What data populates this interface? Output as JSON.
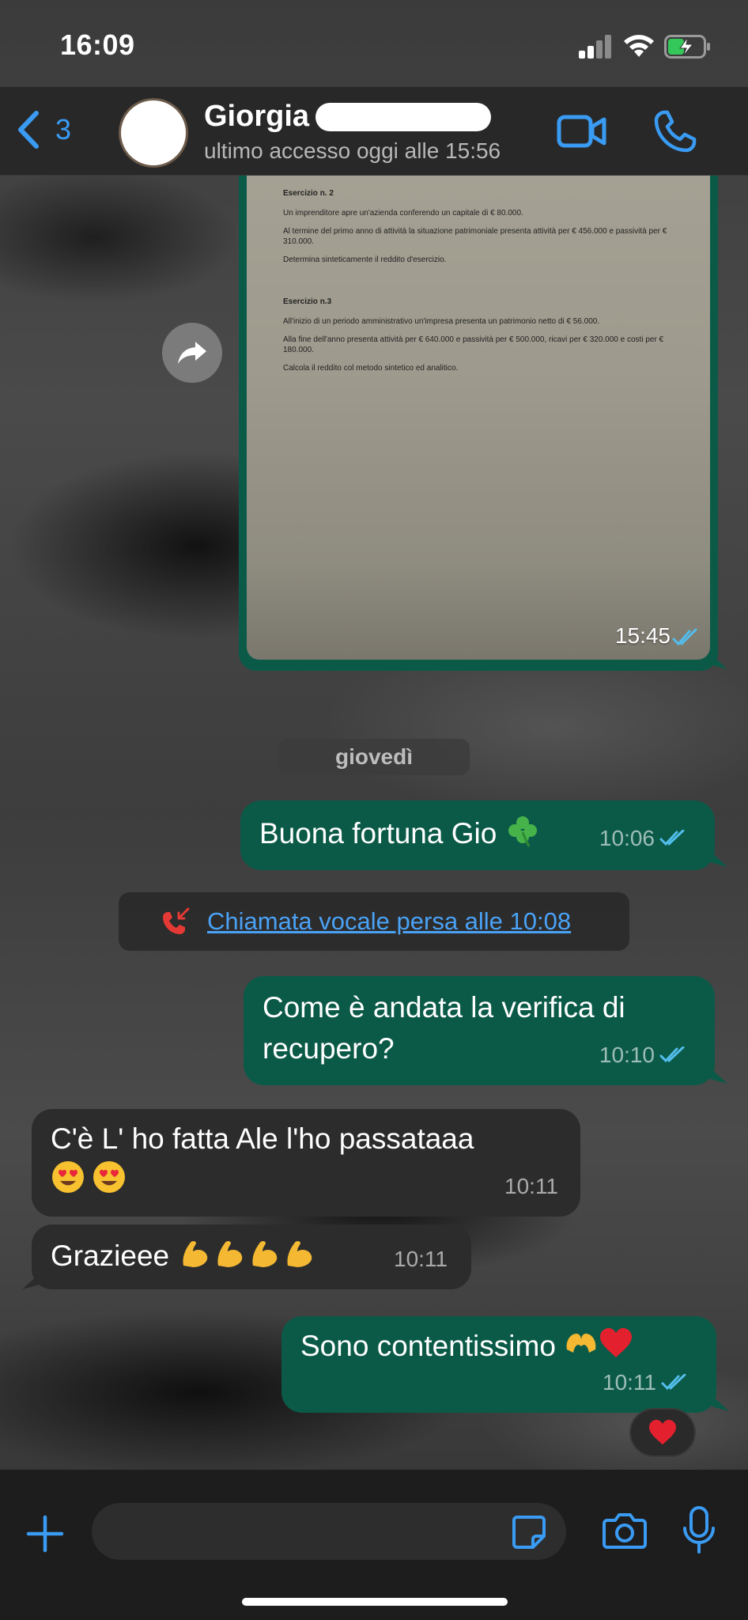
{
  "status_bar": {
    "time": "16:09"
  },
  "header": {
    "back_count": "3",
    "contact_name": "Giorgia",
    "contact_status": "ultimo accesso oggi alle 15:56"
  },
  "image_message": {
    "time": "15:45",
    "document": {
      "ex2_title": "Esercizio n. 2",
      "ex2_p1": "Un imprenditore apre un'azienda conferendo un capitale di € 80.000.",
      "ex2_p2": "Al termine del primo anno di attività la situazione patrimoniale presenta attività per € 456.000 e passività per € 310.000.",
      "ex2_p3": "Determina sinteticamente il reddito d'esercizio.",
      "ex3_title": "Esercizio n.3",
      "ex3_p1": "All'inizio di un periodo amministrativo un'impresa presenta un patrimonio netto di € 56.000.",
      "ex3_p2": "Alla fine dell'anno presenta attività per € 640.000 e passività per € 500.000, ricavi per € 320.000 e costi per € 180.000.",
      "ex3_p3": "Calcola il reddito col metodo sintetico ed analitico."
    }
  },
  "date_divider": "giovedì",
  "messages": [
    {
      "direction": "out",
      "text": "Buona fortuna Gio",
      "emoji": "four-leaf-clover",
      "time": "10:06"
    },
    {
      "direction": "out",
      "text": "Come è andata la verifica di recupero?",
      "time": "10:10"
    },
    {
      "direction": "in",
      "text": "C'è L' ho fatta Ale l'ho passataaa",
      "emoji": "heart-eyes x2",
      "time": "10:11"
    },
    {
      "direction": "in",
      "text": "Grazieee",
      "emoji": "flexed-biceps x4",
      "time": "10:11"
    },
    {
      "direction": "out",
      "text": "Sono contentissimo",
      "emoji": "heart-hands red-heart",
      "time": "10:11",
      "reaction": "red-heart"
    }
  ],
  "missed_call": "Chiamata vocale persa alle 10:08",
  "colors": {
    "accent": "#3a9bf3",
    "outgoing_bubble": "#0b5a48",
    "incoming_bubble": "#2c2c2d",
    "missed_call_icon": "#e53935",
    "read_ticks": "#53bdeb"
  }
}
